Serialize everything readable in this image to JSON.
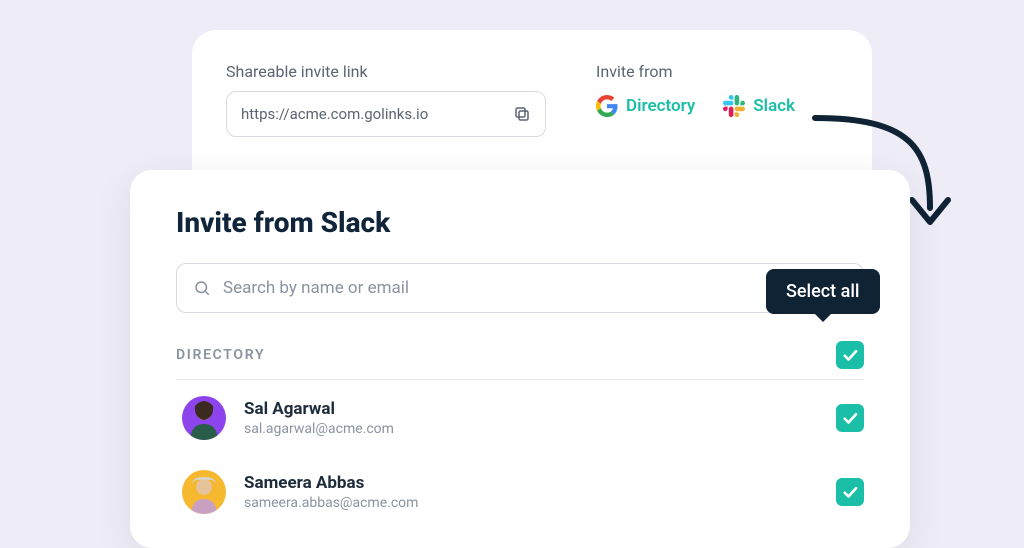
{
  "back": {
    "share_label": "Shareable invite link",
    "share_url": "https://acme.com.golinks.io",
    "invite_from_label": "Invite from",
    "providers": {
      "google": "Directory",
      "slack": "Slack"
    }
  },
  "front": {
    "title": "Invite from Slack",
    "search_placeholder": "Search by name or email",
    "section_label": "DIRECTORY",
    "select_all_tooltip": "Select all",
    "people": [
      {
        "name": "Sal Agarwal",
        "email": "sal.agarwal@acme.com",
        "avatar_color": "purple",
        "checked": true
      },
      {
        "name": "Sameera Abbas",
        "email": "sameera.abbas@acme.com",
        "avatar_color": "yellow",
        "checked": true
      }
    ]
  },
  "colors": {
    "accent": "#1bbfa7",
    "dark": "#0f2335"
  }
}
